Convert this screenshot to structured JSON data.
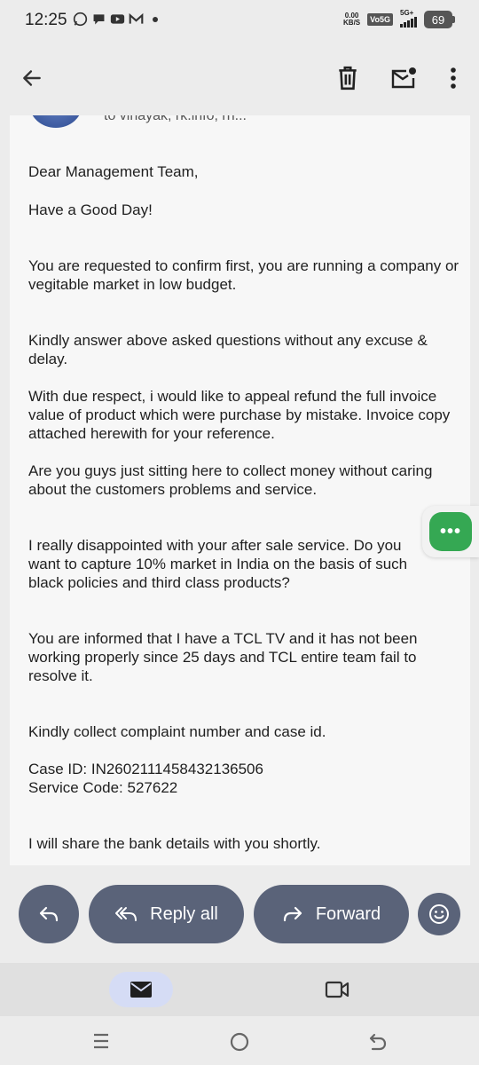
{
  "status_bar": {
    "time": "12:25",
    "speed_value": "0.00",
    "speed_unit": "KB/S",
    "volte": "Vo5G",
    "network": "5G+",
    "battery": "69"
  },
  "email": {
    "to_line": "to vinayak, rk.info, rn...",
    "paragraphs": [
      "Dear Management Team,",
      "Have a Good Day!",
      "You are requested to confirm first, you are running a company or vegitable market in low budget.",
      "Kindly answer above asked questions without any excuse & delay.",
      "With due respect, i would like to appeal refund the full invoice value of product which were purchase by mistake. Invoice copy attached herewith for your reference.",
      "Are you guys just sitting here to collect money without caring about the customers problems and service.",
      "I really disappointed with your after sale service. Do you want to capture 10% market in India on the basis of such black policies and third class products?",
      "You are informed that I have a TCL TV and it has not been working properly since 25 days and TCL entire team fail to resolve it.",
      "Kindly collect complaint number and case id.",
      "Case ID: IN2602111458432136506",
      "Service Code: 527622",
      "I will share the bank details with you shortly."
    ]
  },
  "actions": {
    "reply_all_label": "Reply all",
    "forward_label": "Forward"
  },
  "fab": {
    "label": "•••"
  },
  "colors": {
    "accent_pill": "#5a6379",
    "fab_green": "#35a853",
    "nav_active": "#d5dcf5"
  }
}
